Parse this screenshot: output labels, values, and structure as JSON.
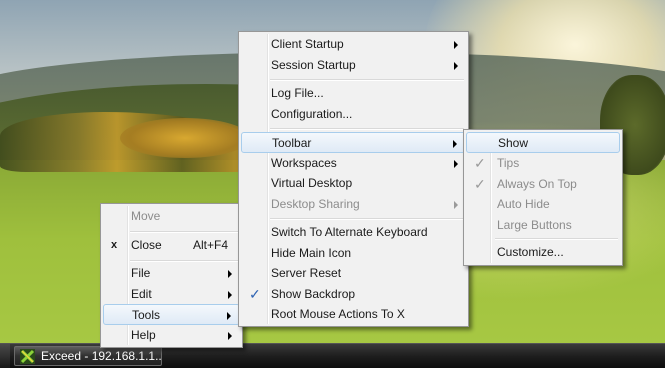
{
  "taskbar": {
    "button_label": "Exceed - 192.168.1.1...",
    "button_icon": "exceed-x-icon"
  },
  "window_menu": {
    "items": [
      {
        "label": "Move",
        "enabled": false
      },
      {
        "label": "Close",
        "accelerator": "Alt+F4",
        "icon": "x"
      },
      {
        "label": "File",
        "submenu": true
      },
      {
        "label": "Edit",
        "submenu": true
      },
      {
        "label": "Tools",
        "submenu": true,
        "highlighted": true
      },
      {
        "label": "Help",
        "submenu": true
      }
    ]
  },
  "main_menu": {
    "items": [
      {
        "label": "Client Startup",
        "submenu": true
      },
      {
        "label": "Session Startup",
        "submenu": true
      },
      {
        "label": "Log File..."
      },
      {
        "label": "Configuration..."
      },
      {
        "label": "Toolbar",
        "submenu": true,
        "highlighted": true
      },
      {
        "label": "Workspaces",
        "submenu": true
      },
      {
        "label": "Virtual Desktop"
      },
      {
        "label": "Desktop Sharing",
        "submenu": true,
        "enabled": false
      },
      {
        "label": "Switch To Alternate Keyboard"
      },
      {
        "label": "Hide Main Icon"
      },
      {
        "label": "Server Reset"
      },
      {
        "label": "Show Backdrop",
        "checked": true
      },
      {
        "label": "Root Mouse Actions To X"
      }
    ]
  },
  "toolbar_menu": {
    "items": [
      {
        "label": "Show",
        "highlighted": true
      },
      {
        "label": "Tips",
        "checked": true,
        "enabled": false
      },
      {
        "label": "Always On Top",
        "checked": true,
        "enabled": false
      },
      {
        "label": "Auto Hide",
        "enabled": false
      },
      {
        "label": "Large Buttons",
        "enabled": false
      },
      {
        "label": "Customize..."
      }
    ]
  },
  "glyphs": {
    "check": "✓",
    "close_x": "x"
  },
  "colors": {
    "highlight_border": "#a8cdec",
    "check_blue": "#2e63b3",
    "disabled_text": "#8c8c8c",
    "menu_background": "#f1f1f1"
  }
}
